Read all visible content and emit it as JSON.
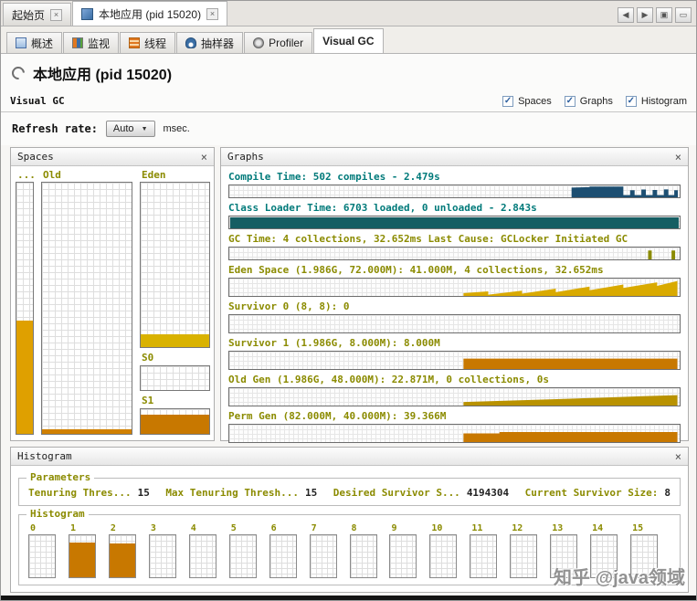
{
  "window": {
    "doc_tabs": [
      {
        "label": "起始页",
        "active": false
      },
      {
        "label": "本地应用 (pid 15020)",
        "active": true
      }
    ],
    "window_controls": [
      {
        "name": "back-arrow-icon",
        "glyph": "◀"
      },
      {
        "name": "forward-arrow-icon",
        "glyph": "▶"
      },
      {
        "name": "float-window-icon",
        "glyph": "▣"
      },
      {
        "name": "minimize-window-icon",
        "glyph": "▭"
      }
    ],
    "view_tabs": [
      {
        "id": "overview",
        "label": "概述",
        "icon": "overview-icon",
        "active": false
      },
      {
        "id": "monitor",
        "label": "监视",
        "icon": "monitor-icon",
        "active": false
      },
      {
        "id": "threads",
        "label": "线程",
        "icon": "threads-icon",
        "active": false
      },
      {
        "id": "sampler",
        "label": "抽样器",
        "icon": "sampler-icon",
        "active": false
      },
      {
        "id": "profiler",
        "label": "Profiler",
        "icon": "profiler-icon",
        "active": false
      },
      {
        "id": "visualgc",
        "label": "Visual GC",
        "icon": null,
        "active": true
      }
    ],
    "page_title": "本地应用 (pid 15020)"
  },
  "icons": {
    "tab_close": "×",
    "panel_close": "×",
    "dropdown_arrow": "▼",
    "check": "✓"
  },
  "toolbar": {
    "title": "Visual GC",
    "checkboxes": [
      {
        "id": "spaces",
        "label": "Spaces",
        "checked": true
      },
      {
        "id": "graphs",
        "label": "Graphs",
        "checked": true
      },
      {
        "id": "histogram",
        "label": "Histogram",
        "checked": true
      }
    ]
  },
  "refresh": {
    "label": "Refresh rate:",
    "value": "Auto",
    "unit": "msec."
  },
  "spaces": {
    "title": "Spaces",
    "perm": {
      "label": "...",
      "fill_pct": 45,
      "color": "#dfa000"
    },
    "old": {
      "label": "Old",
      "fill_pct": 2,
      "color": "#d08000"
    },
    "eden": {
      "label": "Eden",
      "fill_pct": 8,
      "color": "#d9b200"
    },
    "s0": {
      "label": "S0",
      "fill_pct": 0,
      "color": "#c87800"
    },
    "s1": {
      "label": "S1",
      "fill_pct": 76,
      "color": "#c87800"
    }
  },
  "graphs": {
    "title": "Graphs",
    "rows": [
      {
        "label": "Compile Time: 502 compiles - 2.479s",
        "label_color": "#007a7a",
        "fill_color": "#1d4f72",
        "points": [
          [
            0.76,
            0
          ],
          [
            0.76,
            0.82
          ],
          [
            0.8,
            0.86
          ],
          [
            0.8,
            0.9
          ],
          [
            0.875,
            0.9
          ],
          [
            0.875,
            0.18
          ],
          [
            0.89,
            0.18
          ],
          [
            0.89,
            0.6
          ],
          [
            0.9,
            0.6
          ],
          [
            0.9,
            0.18
          ],
          [
            0.915,
            0.18
          ],
          [
            0.915,
            0.65
          ],
          [
            0.925,
            0.65
          ],
          [
            0.925,
            0.18
          ],
          [
            0.94,
            0.18
          ],
          [
            0.94,
            0.62
          ],
          [
            0.95,
            0.62
          ],
          [
            0.95,
            0.18
          ],
          [
            0.965,
            0.18
          ],
          [
            0.965,
            0.66
          ],
          [
            0.975,
            0.66
          ],
          [
            0.975,
            0.18
          ],
          [
            0.988,
            0.18
          ],
          [
            0.988,
            0.6
          ],
          [
            0.996,
            0.6
          ],
          [
            0.996,
            0
          ]
        ]
      },
      {
        "label": "Class Loader Time: 6703 loaded, 0 unloaded - 2.843s",
        "label_color": "#007a7a",
        "fill_color": "#155e63",
        "points": [
          [
            0.002,
            0
          ],
          [
            0.002,
            0.92
          ],
          [
            0.998,
            0.92
          ],
          [
            0.998,
            0
          ]
        ]
      },
      {
        "label": "GC Time: 4 collections, 32.652ms Last Cause: GCLocker Initiated GC",
        "label_color": "#8b8b00",
        "fill_color": "#8b8b00",
        "points": [
          [
            0.93,
            0
          ],
          [
            0.93,
            0.75
          ],
          [
            0.938,
            0.75
          ],
          [
            0.938,
            0
          ],
          [
            0.982,
            0
          ],
          [
            0.982,
            0.75
          ],
          [
            0.99,
            0.75
          ],
          [
            0.99,
            0
          ]
        ]
      },
      {
        "label": "Eden Space (1.986G, 72.000M): 41.000M, 4 collections, 32.652ms",
        "label_color": "#8b8b00",
        "fill_color": "#d9aa00",
        "points": [
          [
            0.52,
            0
          ],
          [
            0.52,
            0.16
          ],
          [
            0.575,
            0.26
          ],
          [
            0.575,
            0.07
          ],
          [
            0.65,
            0.3
          ],
          [
            0.65,
            0.13
          ],
          [
            0.725,
            0.42
          ],
          [
            0.725,
            0.22
          ],
          [
            0.8,
            0.54
          ],
          [
            0.8,
            0.33
          ],
          [
            0.875,
            0.66
          ],
          [
            0.875,
            0.46
          ],
          [
            0.95,
            0.78
          ],
          [
            0.95,
            0.58
          ],
          [
            0.995,
            0.86
          ],
          [
            0.995,
            0
          ]
        ]
      },
      {
        "label": "Survivor 0 (8, 8): 0",
        "label_color": "#8b8b00",
        "fill_color": "#c87800",
        "points": []
      },
      {
        "label": "Survivor 1 (1.986G, 8.000M): 8.000M",
        "label_color": "#8b8b00",
        "fill_color": "#c87800",
        "points": [
          [
            0.52,
            0
          ],
          [
            0.52,
            0.6
          ],
          [
            0.995,
            0.6
          ],
          [
            0.995,
            0
          ]
        ]
      },
      {
        "label": "Old Gen (1.986G, 48.000M): 22.871M, 0 collections, 0s",
        "label_color": "#8b8b00",
        "fill_color": "#b99200",
        "points": [
          [
            0.52,
            0
          ],
          [
            0.52,
            0.2
          ],
          [
            0.62,
            0.28
          ],
          [
            0.72,
            0.36
          ],
          [
            0.82,
            0.45
          ],
          [
            0.92,
            0.54
          ],
          [
            0.995,
            0.6
          ],
          [
            0.995,
            0
          ]
        ]
      },
      {
        "label": "Perm Gen (82.000M, 40.000M): 39.366M",
        "label_color": "#8b8b00",
        "fill_color": "#c87800",
        "points": [
          [
            0.52,
            0
          ],
          [
            0.52,
            0.5
          ],
          [
            0.6,
            0.5
          ],
          [
            0.6,
            0.58
          ],
          [
            0.995,
            0.58
          ],
          [
            0.995,
            0
          ]
        ]
      }
    ]
  },
  "histogram": {
    "title": "Histogram",
    "parameters": {
      "title": "Parameters",
      "items": [
        {
          "label": "Tenuring Thres...",
          "value": "15"
        },
        {
          "label": "Max Tenuring Thresh...",
          "value": "15"
        },
        {
          "label": "Desired Survivor S...",
          "value": "4194304"
        },
        {
          "label": "Current Survivor Size:",
          "value": "8"
        }
      ]
    },
    "bars": {
      "title": "Histogram",
      "fill_color": "#c87800",
      "bins": [
        {
          "label": "0",
          "fill_pct": 0
        },
        {
          "label": "1",
          "fill_pct": 82
        },
        {
          "label": "2",
          "fill_pct": 80
        },
        {
          "label": "3",
          "fill_pct": 0
        },
        {
          "label": "4",
          "fill_pct": 0
        },
        {
          "label": "5",
          "fill_pct": 0
        },
        {
          "label": "6",
          "fill_pct": 0
        },
        {
          "label": "7",
          "fill_pct": 0
        },
        {
          "label": "8",
          "fill_pct": 0
        },
        {
          "label": "9",
          "fill_pct": 0
        },
        {
          "label": "10",
          "fill_pct": 0
        },
        {
          "label": "11",
          "fill_pct": 0
        },
        {
          "label": "12",
          "fill_pct": 0
        },
        {
          "label": "13",
          "fill_pct": 0
        },
        {
          "label": "14",
          "fill_pct": 0
        },
        {
          "label": "15",
          "fill_pct": 0
        }
      ]
    }
  },
  "watermark": "知乎 @java领域"
}
